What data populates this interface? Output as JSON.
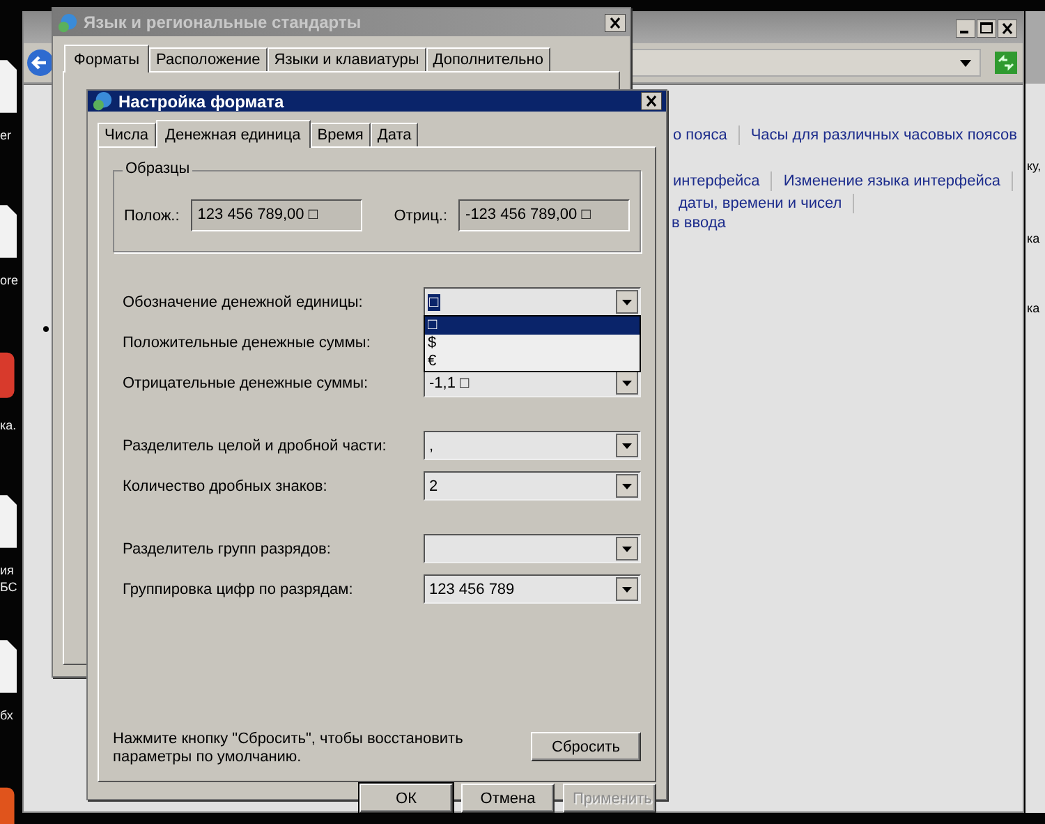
{
  "desktop_icons": [
    {
      "kind": "document",
      "label": [
        "er"
      ]
    },
    {
      "kind": "document",
      "label": [
        "ore"
      ]
    },
    {
      "kind": "app",
      "color": "#d83a2c",
      "label": [
        "ка."
      ]
    },
    {
      "kind": "document",
      "label": [
        "ия",
        "БС"
      ]
    },
    {
      "kind": "document",
      "label": [
        "бх"
      ]
    },
    {
      "kind": "app",
      "color": "#e0541c"
    }
  ],
  "control_panel": {
    "link_rows": [
      {
        "links": [
          "о пояса",
          "Часы для различных часовых поясов"
        ],
        "trailing_separator": false
      },
      {
        "links": [
          "интерфейса",
          "Изменение языка интерфейса"
        ],
        "trailing_separator": true
      },
      {
        "links": [
          "даты, времени и чисел"
        ],
        "trailing_separator": true
      },
      {
        "links": [
          "в ввода"
        ],
        "trailing_separator": false
      }
    ]
  },
  "right_window": {
    "fragments": [
      "ку,",
      "ка",
      "ка"
    ]
  },
  "region_dialog": {
    "title": "Язык и региональные стандарты",
    "active": false,
    "tabs": [
      {
        "label": "Форматы",
        "selected": true
      },
      {
        "label": "Расположение",
        "selected": false
      },
      {
        "label": "Языки и клавиатуры",
        "selected": false
      },
      {
        "label": "Дополнительно",
        "selected": false
      }
    ]
  },
  "format_dialog": {
    "title": "Настройка формата",
    "active": true,
    "tabs": [
      {
        "label": "Числа",
        "selected": false
      },
      {
        "label": "Денежная единица",
        "selected": true
      },
      {
        "label": "Время",
        "selected": false
      },
      {
        "label": "Дата",
        "selected": false
      }
    ],
    "samples": {
      "title": "Образцы",
      "items": [
        {
          "label": "Полож.:",
          "value": "123 456 789,00 □"
        },
        {
          "label": "Отриц.:",
          "value": "-123 456 789,00 □"
        }
      ]
    },
    "combo_groups": [
      [
        {
          "label": "Обозначение денежной единицы:",
          "value": "□",
          "focused": true,
          "dropdown": [
            {
              "text": "□",
              "selected": true
            },
            {
              "text": "$",
              "selected": false
            },
            {
              "text": "€",
              "selected": false
            }
          ]
        },
        {
          "label": "Положительные денежные суммы:"
        },
        {
          "label": "Отрицательные денежные суммы:",
          "value": "-1,1 □",
          "focused": false
        }
      ],
      [
        {
          "label": "Разделитель целой и дробной части:",
          "value": ",",
          "focused": false
        },
        {
          "label": "Количество дробных знаков:",
          "value": "2",
          "focused": false
        }
      ],
      [
        {
          "label": "Разделитель групп разрядов:"
        },
        {
          "label": "Группировка цифр по разрядам:",
          "value": "123 456 789",
          "focused": false
        }
      ]
    ],
    "note": "Нажмите кнопку \"Сбросить\", чтобы восстановить параметры по умолчанию.",
    "reset_button": "Сбросить",
    "buttons": [
      {
        "label": "ОК",
        "disabled": false,
        "default": true
      },
      {
        "label": "Отмена",
        "disabled": false,
        "default": false
      },
      {
        "label": "Применить",
        "disabled": true,
        "default": false
      }
    ]
  }
}
